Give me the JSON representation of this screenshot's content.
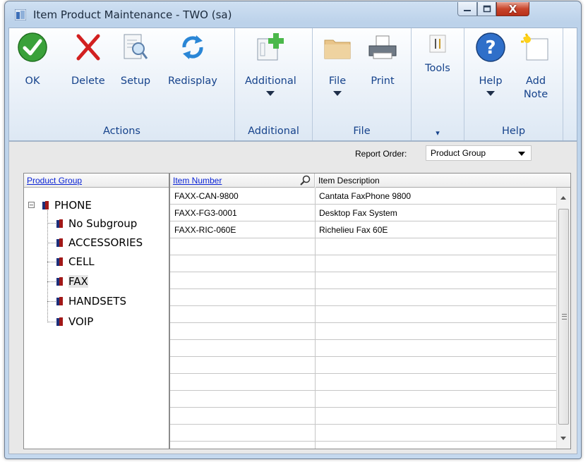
{
  "window": {
    "title": "Item Product Maintenance  -  TWO (sa)"
  },
  "caption_buttons": {
    "minimize": "—",
    "maximize": "☐",
    "close": "X"
  },
  "ribbon": {
    "actions": {
      "label": "Actions",
      "ok": "OK",
      "delete": "Delete",
      "setup": "Setup",
      "redisplay": "Redisplay"
    },
    "additional": {
      "label": "Additional",
      "additional": "Additional"
    },
    "file": {
      "label": "File",
      "file": "File",
      "print": "Print"
    },
    "tools": {
      "tools": "Tools"
    },
    "help": {
      "label": "Help",
      "help": "Help",
      "add_note_1": "Add",
      "add_note_2": "Note"
    }
  },
  "report_order": {
    "label": "Report Order:",
    "value": "Product Group"
  },
  "tree": {
    "header": "Product Group",
    "root": "PHONE",
    "children": [
      "No Subgroup",
      "ACCESSORIES",
      "CELL",
      "FAX",
      "HANDSETS",
      "VOIP"
    ],
    "selected": "FAX"
  },
  "grid": {
    "headers": {
      "item_number": "Item Number",
      "item_description": "Item Description"
    },
    "rows": [
      {
        "item_number": "FAXX-CAN-9800",
        "item_description": "Cantata FaxPhone 9800"
      },
      {
        "item_number": "FAXX-FG3-0001",
        "item_description": "Desktop Fax System"
      },
      {
        "item_number": "FAXX-RIC-060E",
        "item_description": "Richelieu Fax 60E"
      }
    ]
  }
}
